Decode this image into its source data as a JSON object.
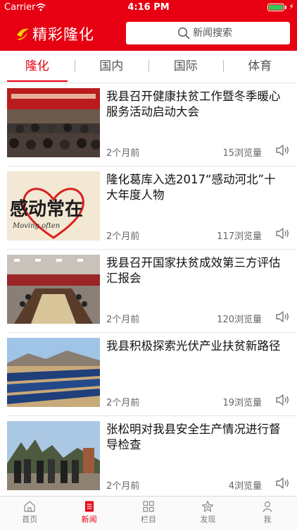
{
  "status_bar": {
    "carrier": "Carrier",
    "time": "4:16 PM",
    "battery_level": 1.0
  },
  "header": {
    "app_title": "精彩隆化",
    "search_placeholder": "新闻搜索"
  },
  "tabs": [
    {
      "label": "隆化",
      "active": true
    },
    {
      "label": "国内",
      "active": false
    },
    {
      "label": "国际",
      "active": false
    },
    {
      "label": "体育",
      "active": false
    }
  ],
  "news": [
    {
      "title": "我县召开健康扶贫工作暨冬季暖心服务活动启动大会",
      "time": "2个月前",
      "views": "15浏览量"
    },
    {
      "title": "隆化葛库入选2017“感动河北”十大年度人物",
      "time": "2个月前",
      "views": "117浏览量",
      "image_text": {
        "main": "感动常在",
        "sub": "Moving often"
      }
    },
    {
      "title": "我县召开国家扶贫成效第三方评估汇报会",
      "time": "2个月前",
      "views": "120浏览量"
    },
    {
      "title": "我县积极探索光伏产业扶贫新路径",
      "time": "2个月前",
      "views": "19浏览量"
    },
    {
      "title": "张松明对我县安全生产情况进行督导检查",
      "time": "2个月前",
      "views": "4浏览量"
    }
  ],
  "tab_bar": [
    {
      "label": "首页",
      "icon": "home-icon",
      "active": false
    },
    {
      "label": "新闻",
      "icon": "news-icon",
      "active": true
    },
    {
      "label": "栏目",
      "icon": "grid-icon",
      "active": false
    },
    {
      "label": "发现",
      "icon": "discover-icon",
      "active": false
    },
    {
      "label": "我",
      "icon": "profile-icon",
      "active": false
    }
  ],
  "colors": {
    "brand": "#e60012",
    "battery": "#35c759"
  }
}
